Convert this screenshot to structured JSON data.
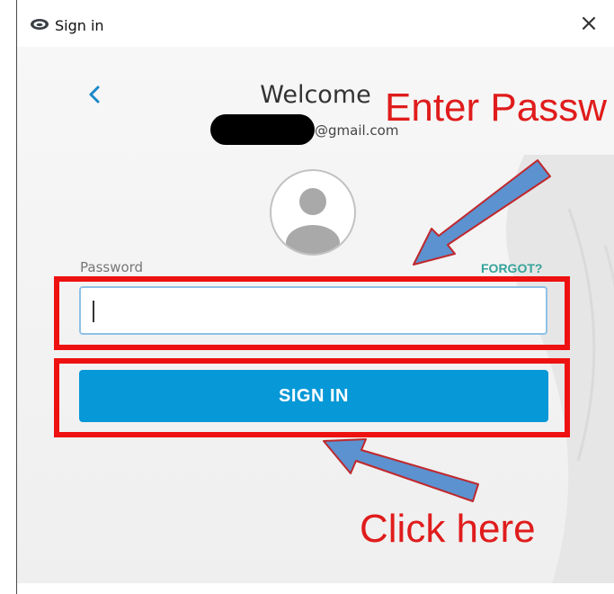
{
  "window": {
    "title": "Sign in",
    "close_glyph": "×",
    "icon": "cloud-app-icon"
  },
  "signin": {
    "back_icon": "chevron-left-icon",
    "heading": "Welcome",
    "email_domain": "@gmail.com",
    "avatar_icon": "user-avatar-icon",
    "password_label": "Password",
    "forgot_label": "FORGOT?",
    "password_value": "",
    "submit_label": "SIGN IN"
  },
  "annotations": {
    "enter_password": "Enter Passw",
    "click_here": "Click here",
    "highlight_color": "#ee1111",
    "arrow_color": "#5b92cf",
    "arrow_outline": "#c0282c"
  },
  "colors": {
    "accent_button": "#0798d7",
    "forgot_link": "#35a39a",
    "input_border": "#8fc1e6"
  }
}
